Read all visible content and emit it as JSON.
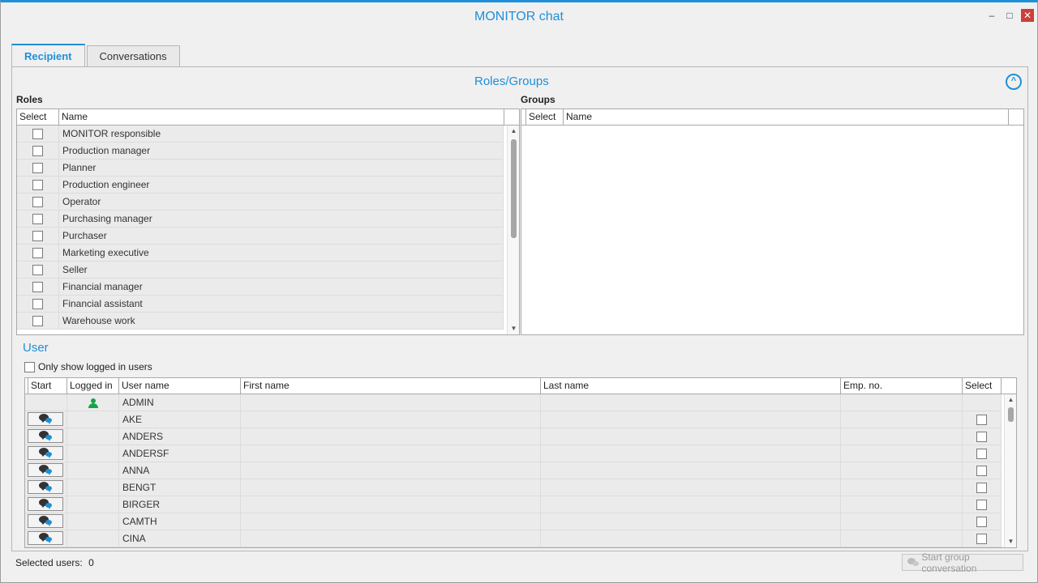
{
  "window": {
    "title": "MONITOR chat",
    "controls": {
      "minimize": "–",
      "maximize": "□",
      "close": "✕"
    }
  },
  "tabs": [
    {
      "label": "Recipient"
    },
    {
      "label": "Conversations"
    }
  ],
  "roles_groups": {
    "title": "Roles/Groups",
    "roles_label": "Roles",
    "groups_label": "Groups",
    "roles_columns": {
      "select": "Select",
      "name": "Name"
    },
    "groups_columns": {
      "select": "Select",
      "name": "Name"
    },
    "roles": [
      "MONITOR responsible",
      "Production manager",
      "Planner",
      "Production engineer",
      "Operator",
      "Purchasing manager",
      "Purchaser",
      "Marketing executive",
      "Seller",
      "Financial manager",
      "Financial assistant",
      "Warehouse work"
    ]
  },
  "user": {
    "title": "User",
    "only_logged_in_label": "Only show logged in users",
    "columns": {
      "start": "Start",
      "logged_in": "Logged in",
      "user_name": "User name",
      "first_name": "First name",
      "last_name": "Last name",
      "emp_no": "Emp. no.",
      "select": "Select"
    },
    "rows": [
      {
        "user_name": "ADMIN",
        "logged_in": true,
        "has_start": false,
        "has_select": false
      },
      {
        "user_name": "AKE",
        "logged_in": false,
        "has_start": true,
        "has_select": true
      },
      {
        "user_name": "ANDERS",
        "logged_in": false,
        "has_start": true,
        "has_select": true
      },
      {
        "user_name": "ANDERSF",
        "logged_in": false,
        "has_start": true,
        "has_select": true
      },
      {
        "user_name": "ANNA",
        "logged_in": false,
        "has_start": true,
        "has_select": true
      },
      {
        "user_name": "BENGT",
        "logged_in": false,
        "has_start": true,
        "has_select": true
      },
      {
        "user_name": "BIRGER",
        "logged_in": false,
        "has_start": true,
        "has_select": true
      },
      {
        "user_name": "CAMTH",
        "logged_in": false,
        "has_start": true,
        "has_select": true
      },
      {
        "user_name": "CINA",
        "logged_in": false,
        "has_start": true,
        "has_select": true
      }
    ]
  },
  "footer": {
    "selected_users_label": "Selected users:",
    "selected_users_count": "0",
    "group_button_label": "Start group conversation"
  },
  "colors": {
    "accent": "#1f8fd8",
    "logged_in": "#17a34a",
    "close": "#c9413a"
  },
  "icons": {
    "chat": "chat-bubbles-icon",
    "user": "user-icon",
    "collapse": "chevron-up-icon"
  }
}
